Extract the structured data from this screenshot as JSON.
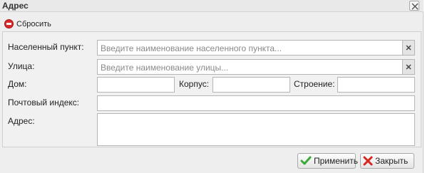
{
  "window": {
    "title": "Адрес"
  },
  "toolbar": {
    "reset_label": "Сбросить"
  },
  "form": {
    "settlement_label": "Населенный пункт:",
    "settlement_placeholder": "Введите наименование населенного пункта...",
    "street_label": "Улица:",
    "street_placeholder": "Введите наименование улицы...",
    "house_label": "Дом:",
    "building_label": "Корпус:",
    "structure_label": "Строение:",
    "postal_label": "Почтовый индекс:",
    "address_label": "Адрес:"
  },
  "footer": {
    "apply_label": "Применить",
    "close_label": "Закрыть"
  },
  "colors": {
    "reset_icon": "#d72a2a",
    "apply_icon": "#3aa935",
    "close_icon": "#d7261e"
  },
  "icons": {
    "title_close": "close-icon",
    "reset": "minus-circle-icon",
    "clear": "clear-icon",
    "apply": "checkmark-icon",
    "close": "cross-icon"
  }
}
